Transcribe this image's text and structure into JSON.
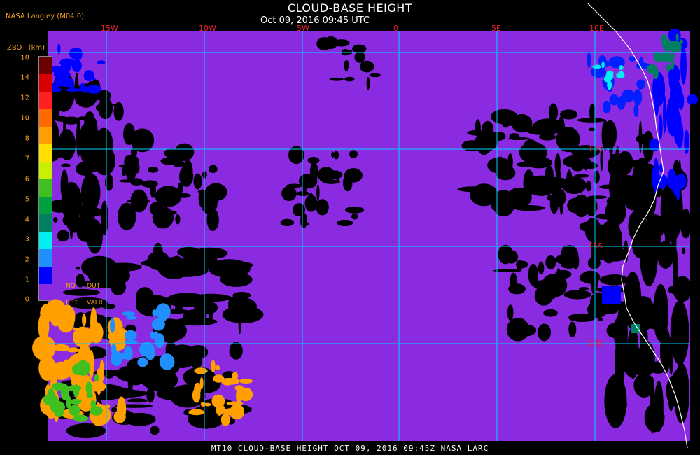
{
  "header": {
    "title": "CLOUD-BASE HEIGHT",
    "subtitle": "Oct 09, 2016 09:45 UTC",
    "source": "NASA Langley (M04.0)"
  },
  "legend": {
    "title": "ZBOT (km)",
    "ticks": [
      "18",
      "14",
      "12",
      "10",
      "8",
      "7",
      "6",
      "5",
      "4",
      "3",
      "2",
      "1",
      "0"
    ],
    "colors": [
      "#6b0000",
      "#d80000",
      "#ff2020",
      "#ff6a00",
      "#ffa000",
      "#ffe000",
      "#c8f000",
      "#40c020",
      "#00a040",
      "#008060",
      "#00f0f0",
      "#2090ff",
      "#0000ff",
      "#8a2be2"
    ],
    "no_ret_label": [
      "NO",
      "RET"
    ],
    "out_valr_label": [
      "OUT",
      "VALR"
    ]
  },
  "map": {
    "longitude_labels": [
      "15W",
      "10W",
      "5W",
      "0",
      "5E",
      "10E"
    ],
    "latitude_labels": [
      "10S",
      "15S",
      "20S"
    ],
    "background_color": "#8a2be2",
    "grid_color": "#00d0ff",
    "coast_color": "#ffffff"
  },
  "footer": {
    "text": "MT10  CLOUD-BASE HEIGHT  OCT 09, 2016 09:45Z  NASA LARC"
  }
}
